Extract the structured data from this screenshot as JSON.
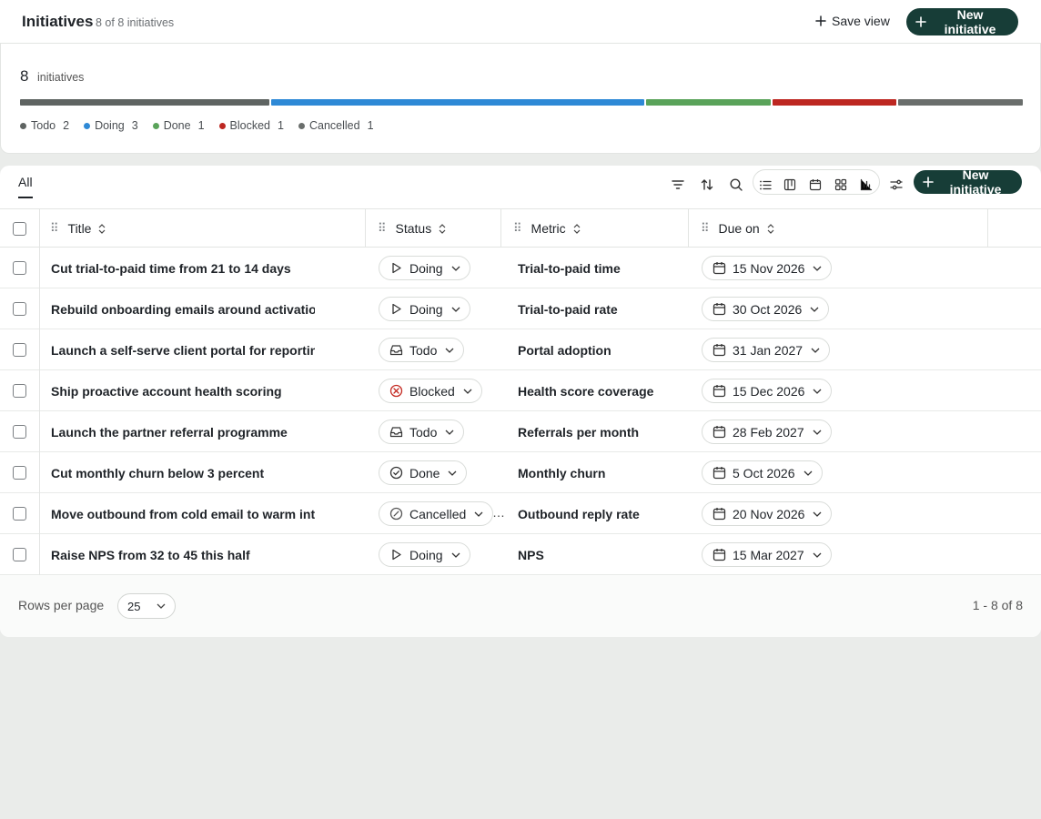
{
  "header": {
    "title": "Initiatives",
    "subtitle": "8 of 8 initiatives",
    "save_view_label": "Save view",
    "new_initiative_label": "New initiative"
  },
  "summary": {
    "count": "8",
    "label": "initiatives",
    "segments": [
      {
        "name": "Todo",
        "count": "2",
        "color": "#5f6462",
        "weight": 2
      },
      {
        "name": "Doing",
        "count": "3",
        "color": "#2e89d6",
        "weight": 3
      },
      {
        "name": "Done",
        "count": "1",
        "color": "#5aa35a",
        "weight": 1
      },
      {
        "name": "Blocked",
        "count": "1",
        "color": "#bd2721",
        "weight": 1
      },
      {
        "name": "Cancelled",
        "count": "1",
        "color": "#6a6e6c",
        "weight": 1
      }
    ]
  },
  "toolbar": {
    "tab_all": "All",
    "new_initiative_label": "New initiative",
    "tools": [
      "filter-icon",
      "sort-icon",
      "search-icon"
    ],
    "views": [
      "list-view-icon",
      "kanban-view-icon",
      "calendar-view-icon",
      "gallery-view-icon",
      "chart-view-icon"
    ],
    "settings": "view-settings-icon"
  },
  "table": {
    "columns": [
      "Title",
      "Status",
      "Metric",
      "Due on"
    ],
    "rows": [
      {
        "title": "Cut trial-to-paid time from 21 to 14 days",
        "status": "Doing",
        "status_icon": "play-icon",
        "metric": "Trial-to-paid time",
        "due": "15 Nov 2026"
      },
      {
        "title": "Rebuild onboarding emails around activation",
        "status": "Doing",
        "status_icon": "play-icon",
        "metric": "Trial-to-paid rate",
        "due": "30 Oct 2026"
      },
      {
        "title": "Launch a self-serve client portal for reporting",
        "status": "Todo",
        "status_icon": "inbox-icon",
        "metric": "Portal adoption",
        "due": "31 Jan 2027"
      },
      {
        "title": "Ship proactive account health scoring",
        "status": "Blocked",
        "status_icon": "blocked-icon",
        "metric": "Health score coverage",
        "due": "15 Dec 2026"
      },
      {
        "title": "Launch the partner referral programme",
        "status": "Todo",
        "status_icon": "inbox-icon",
        "metric": "Referrals per month",
        "due": "28 Feb 2027"
      },
      {
        "title": "Cut monthly churn below 3 percent",
        "status": "Done",
        "status_icon": "check-circle-icon",
        "metric": "Monthly churn",
        "due": "5 Oct 2026"
      },
      {
        "title": "Move outbound from cold email to warm intr...",
        "status": "Cancelled",
        "status_icon": "cancelled-icon",
        "metric": "Outbound reply rate",
        "due": "20 Nov 2026"
      },
      {
        "title": "Raise NPS from 32 to 45 this half",
        "status": "Doing",
        "status_icon": "play-icon",
        "metric": "NPS",
        "due": "15 Mar 2027"
      }
    ]
  },
  "footer": {
    "rows_per_page_label": "Rows per page",
    "rows_per_page_value": "25",
    "page_range": "1 - 8 of 8"
  }
}
